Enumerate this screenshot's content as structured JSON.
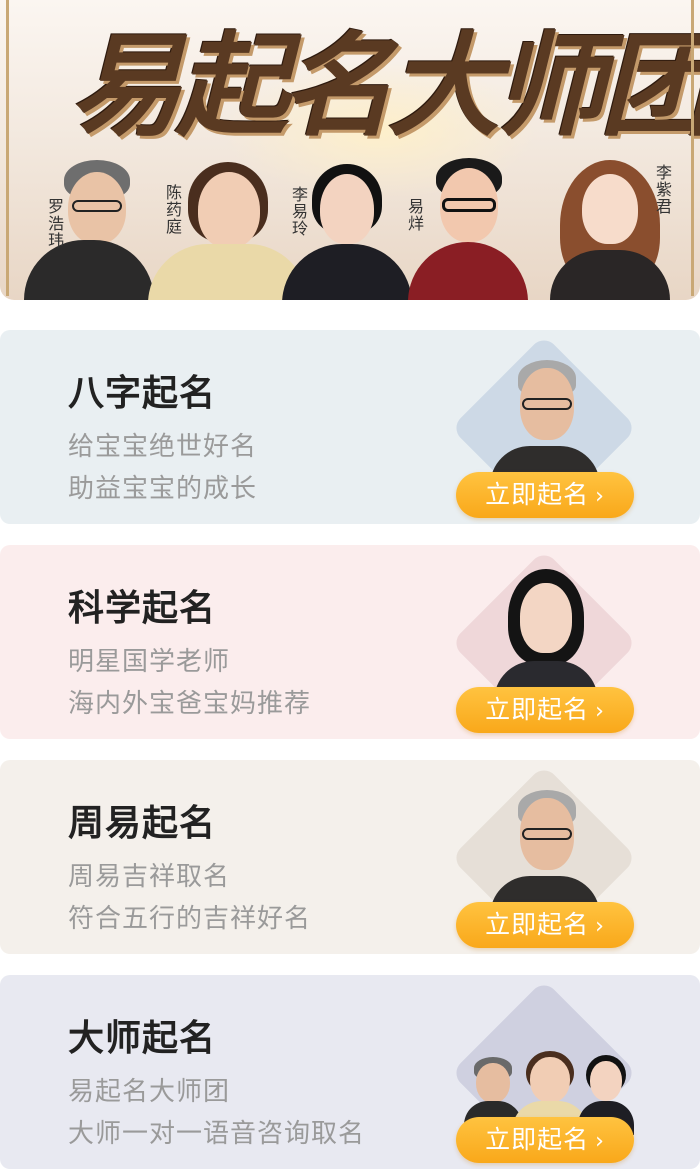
{
  "banner": {
    "title": "易起名大师团",
    "masters": [
      {
        "name": "罗浩玮"
      },
      {
        "name": "陈药庭"
      },
      {
        "name": "李易玲"
      },
      {
        "name": "易烊"
      },
      {
        "name": "李紫君"
      }
    ]
  },
  "cards": [
    {
      "title": "八字起名",
      "line1": "给宝宝绝世好名",
      "line2": "助益宝宝的成长",
      "cta": "立即起名",
      "bg": "#e9eff2",
      "diamond": "#cdd9e6"
    },
    {
      "title": "科学起名",
      "line1": "明星国学老师",
      "line2": "海内外宝爸宝妈推荐",
      "cta": "立即起名",
      "bg": "#fbeded",
      "diamond": "#efd7d9"
    },
    {
      "title": "周易起名",
      "line1": "周易吉祥取名",
      "line2": "符合五行的吉祥好名",
      "cta": "立即起名",
      "bg": "#f4f0eb",
      "diamond": "#e6dfd7"
    },
    {
      "title": "大师起名",
      "line1": "易起名大师团",
      "line2": "大师一对一语音咨询取名",
      "cta": "立即起名",
      "bg": "#e8e9f1",
      "diamond": "#cfd0e0"
    }
  ],
  "icons": {
    "cta_chevron": "chevron-right-icon"
  },
  "colors": {
    "cta": "#f9a81a",
    "title": "#222222",
    "subtitle": "#9a9a9a"
  }
}
